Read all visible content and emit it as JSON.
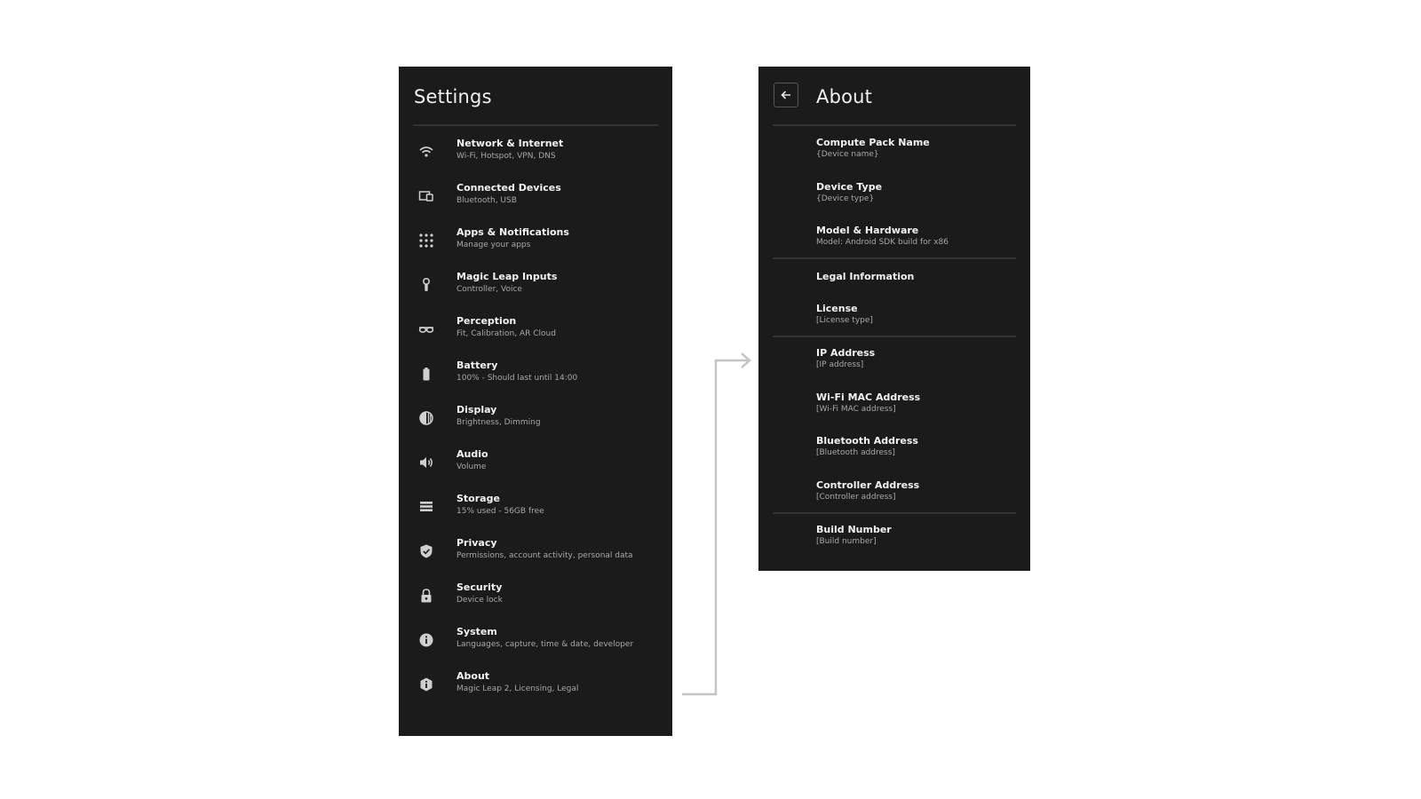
{
  "settings": {
    "title": "Settings",
    "items": [
      {
        "label": "Network & Internet",
        "sub": "Wi-Fi, Hotspot, VPN, DNS",
        "icon": "wifi-icon"
      },
      {
        "label": "Connected Devices",
        "sub": "Bluetooth, USB",
        "icon": "devices-icon"
      },
      {
        "label": "Apps & Notifications",
        "sub": "Manage your apps",
        "icon": "apps-grid-icon"
      },
      {
        "label": "Magic Leap Inputs",
        "sub": "Controller, Voice",
        "icon": "controller-icon"
      },
      {
        "label": "Perception",
        "sub": "Fit, Calibration, AR Cloud",
        "icon": "glasses-icon"
      },
      {
        "label": "Battery",
        "sub": "100% - Should last until 14:00",
        "icon": "battery-icon"
      },
      {
        "label": "Display",
        "sub": "Brightness, Dimming",
        "icon": "brightness-icon"
      },
      {
        "label": "Audio",
        "sub": "Volume",
        "icon": "speaker-icon"
      },
      {
        "label": "Storage",
        "sub": "15% used - 56GB free",
        "icon": "storage-icon"
      },
      {
        "label": "Privacy",
        "sub": "Permissions, account activity, personal data",
        "icon": "shield-icon"
      },
      {
        "label": "Security",
        "sub": "Device lock",
        "icon": "lock-icon"
      },
      {
        "label": "System",
        "sub": "Languages, capture, time & date, developer",
        "icon": "info-icon"
      },
      {
        "label": "About",
        "sub": "Magic Leap 2, Licensing, Legal",
        "icon": "device-info-icon"
      }
    ]
  },
  "about": {
    "title": "About",
    "back_icon": "arrow-left-icon",
    "items": [
      {
        "label": "Compute Pack Name",
        "sub": "{Device name}"
      },
      {
        "label": "Device Type",
        "sub": "{Device type}"
      },
      {
        "label": "Model & Hardware",
        "sub": "Model: Android SDK build for x86"
      },
      {
        "label": "Legal Information",
        "sub": ""
      },
      {
        "label": "License",
        "sub": "[License type]"
      },
      {
        "label": "IP Address",
        "sub": "[IP address]"
      },
      {
        "label": "Wi-Fi MAC Address",
        "sub": "[Wi-Fi MAC address]"
      },
      {
        "label": "Bluetooth Address",
        "sub": "[Bluetooth address]"
      },
      {
        "label": "Controller Address",
        "sub": "[Controller address]"
      },
      {
        "label": "Build Number",
        "sub": "[Build number]"
      }
    ]
  },
  "colors": {
    "page_bg": "#ffffff",
    "panel_bg": "#1b1b1b",
    "primary_text": "#f2f2f2",
    "secondary_text": "#a8a8a8",
    "divider": "#333333",
    "connector": "#c4c4c4"
  }
}
